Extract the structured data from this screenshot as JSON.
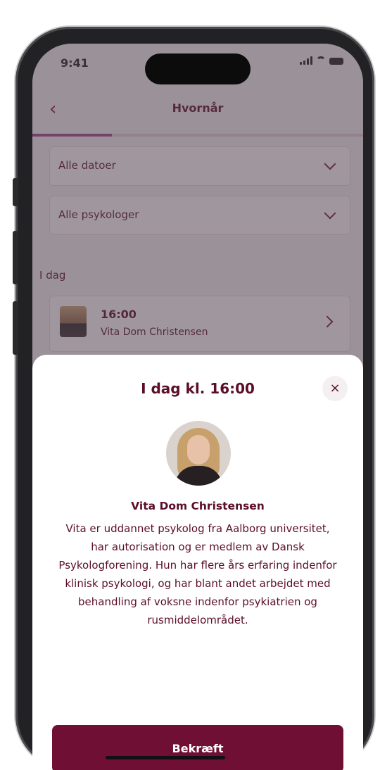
{
  "status_bar": {
    "time": "9:41"
  },
  "header": {
    "title": "Hvornår"
  },
  "progress": {
    "fraction": 0.24
  },
  "filters": {
    "date_label": "Alle datoer",
    "psychologist_label": "Alle psykologer"
  },
  "section": {
    "today_label": "I dag"
  },
  "slot": {
    "time": "16:00",
    "name": "Vita Dom Christensen"
  },
  "sheet": {
    "title": "I dag kl. 16:00",
    "close_label": "×",
    "person_name": "Vita Dom Christensen",
    "bio": "Vita er uddannet psykolog fra Aalborg universitet, har autorisation og er medlem av Dansk Psykologforening. Hun har flere års erfaring indenfor klinisk psykologi, og har blant andet arbejdet med behandling af voksne indenfor psykiatrien og rusmiddelområdet.",
    "confirm_label": "Bekræft"
  },
  "colors": {
    "brand": "#6e0f33",
    "text": "#5b0d2a",
    "progress": "#9d4191"
  }
}
